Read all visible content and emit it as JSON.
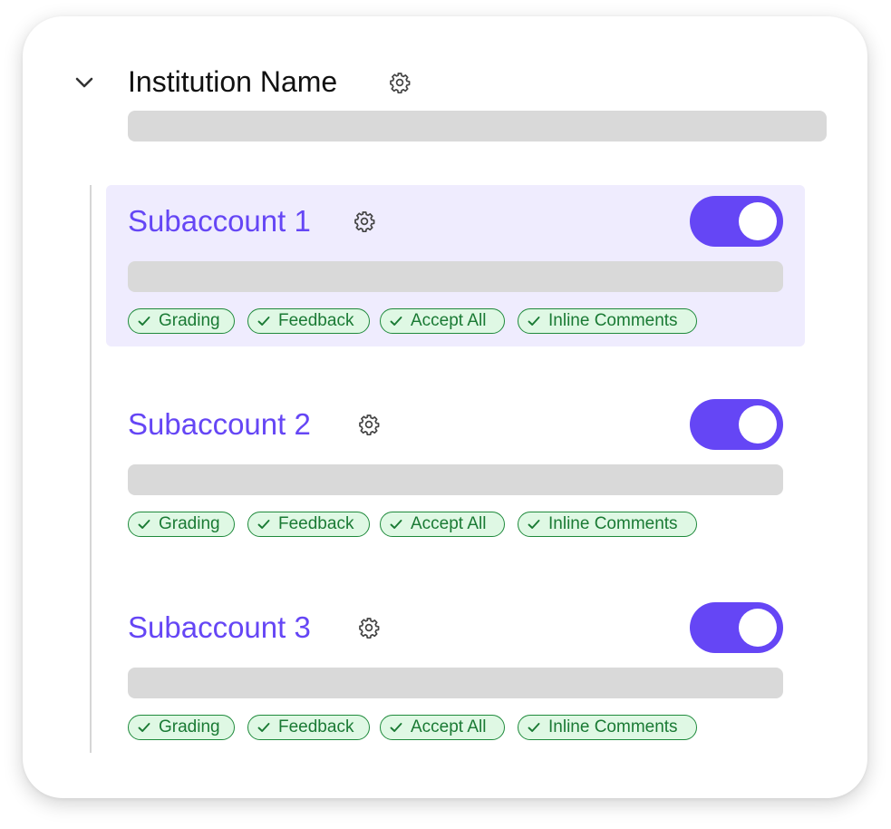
{
  "institution": {
    "name": "Institution Name"
  },
  "subaccounts": [
    {
      "name": "Subaccount 1",
      "enabled": true,
      "highlighted": true,
      "tags": [
        "Grading",
        "Feedback",
        "Accept All",
        "Inline Comments"
      ]
    },
    {
      "name": "Subaccount 2",
      "enabled": true,
      "highlighted": false,
      "tags": [
        "Grading",
        "Feedback",
        "Accept All",
        "Inline Comments"
      ]
    },
    {
      "name": "Subaccount 3",
      "enabled": true,
      "highlighted": false,
      "tags": [
        "Grading",
        "Feedback",
        "Accept All",
        "Inline Comments"
      ]
    }
  ],
  "colors": {
    "accent": "#6546f5",
    "highlight_bg": "#efecfe",
    "tag_border": "#1f8a3c",
    "tag_bg": "#dff8e4",
    "tag_text": "#1a7a34",
    "placeholder": "#d9d9d9"
  },
  "icons": {
    "collapse": "chevron-down-icon",
    "settings": "gear-icon",
    "tag": "check-icon"
  }
}
